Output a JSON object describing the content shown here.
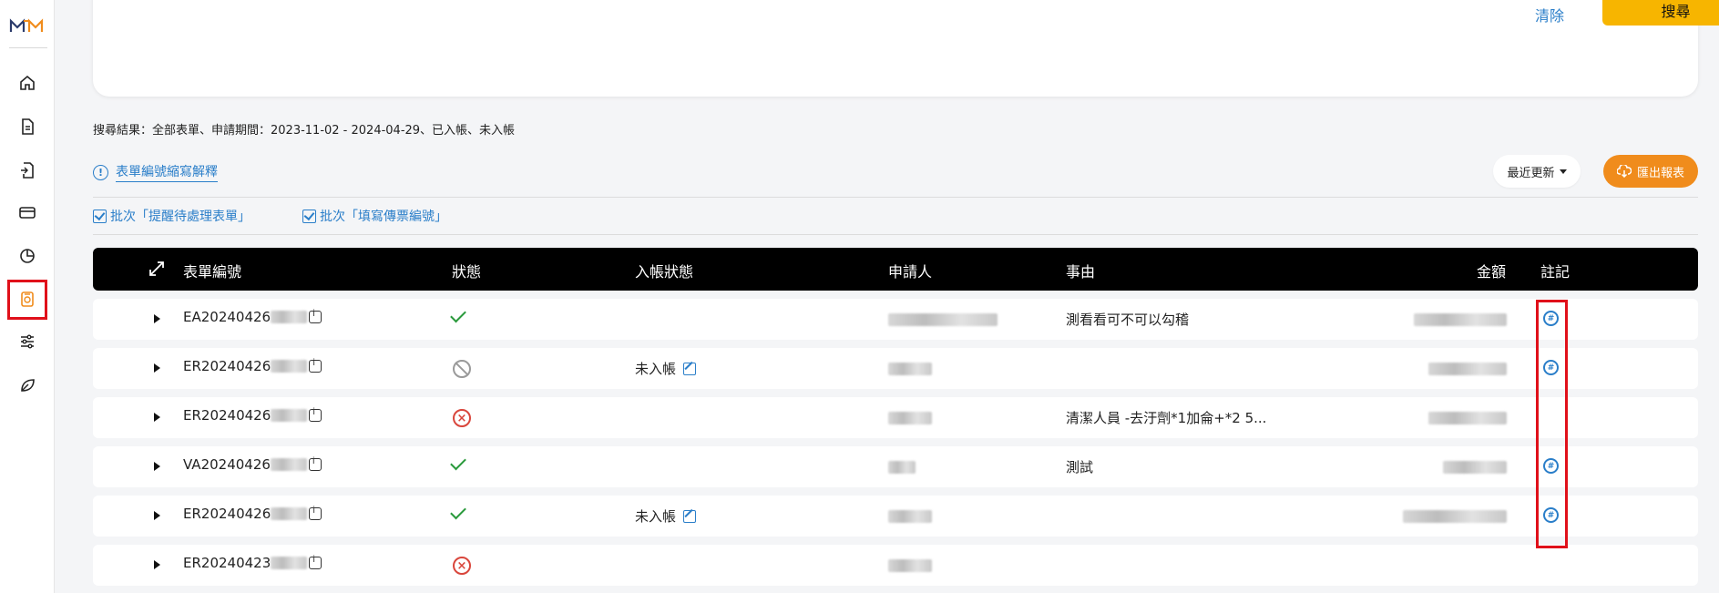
{
  "top_card": {
    "clear_label": "清除",
    "search_label": "搜尋"
  },
  "summary": "搜尋結果：全部表單、申請期間：2023-11-02 - 2024-04-29、已入帳、未入帳",
  "info_link": {
    "icon": "info-icon",
    "label": "表單編號縮寫解釋"
  },
  "sort": {
    "selected": "最近更新",
    "icon": "caret-down-icon"
  },
  "export": {
    "label": "匯出報表",
    "icon": "cloud-download-icon"
  },
  "batch_actions": [
    "批次「提醒待處理表單」",
    "批次「填寫傳票編號」"
  ],
  "table": {
    "headers": [
      "表單編號",
      "狀態",
      "入帳狀態",
      "申請人",
      "事由",
      "金額",
      "註記"
    ],
    "rows": [
      {
        "id": "EA20240426",
        "status": "approved",
        "posting": "",
        "reason": "測看看可不可以勾稽",
        "note": true
      },
      {
        "id": "ER20240426",
        "status": "void",
        "posting": "未入帳",
        "reason": "",
        "note": true
      },
      {
        "id": "ER20240426",
        "status": "rejected",
        "posting": "",
        "reason": "清潔人員 -去汙劑*1加侖+*2 5...",
        "note": false
      },
      {
        "id": "VA20240426",
        "status": "approved",
        "posting": "",
        "reason": "測試",
        "note": true
      },
      {
        "id": "ER20240426",
        "status": "approved",
        "posting": "未入帳",
        "reason": "",
        "note": true
      },
      {
        "id": "ER20240423",
        "status": "rejected",
        "posting": "",
        "reason": "",
        "note": false
      }
    ]
  },
  "sidebar": {
    "items": [
      "home-icon",
      "document-icon",
      "document-return-icon",
      "card-icon",
      "pie-chart-icon",
      "expense-icon",
      "sliders-icon",
      "leaf-icon"
    ],
    "active_index": 5
  },
  "colors": {
    "accent_blue": "#2a7ec9",
    "search_yellow": "#f7b500",
    "export_orange": "#f08c1c",
    "highlight_red": "#e0101a"
  }
}
